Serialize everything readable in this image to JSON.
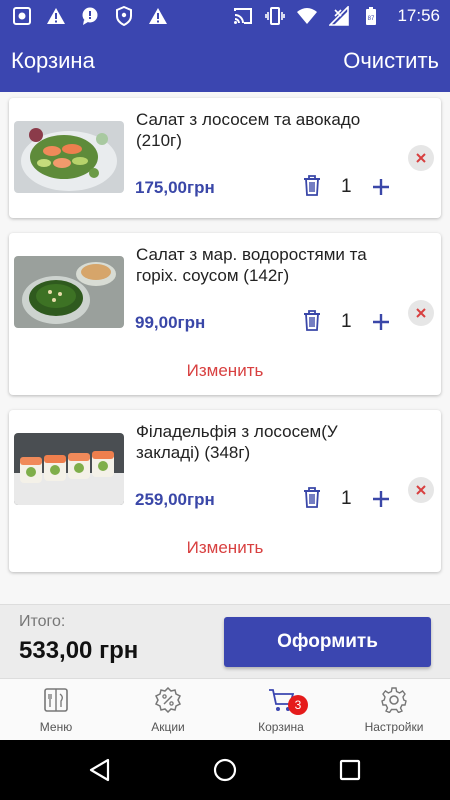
{
  "status_bar": {
    "time": "17:56",
    "left_icons": [
      "screenshot-icon",
      "warning-icon",
      "chat-alert-icon",
      "shield-icon",
      "warning-icon"
    ],
    "right_icons": [
      "cast-icon",
      "vibrate-icon",
      "wifi-icon",
      "signal-icon",
      "battery-icon"
    ],
    "battery_level": "87"
  },
  "app_bar": {
    "title": "Корзина",
    "clear_label": "Очистить"
  },
  "cart": {
    "items": [
      {
        "name": "Салат з лососем та авокадо (210г)",
        "price": "175,00грн",
        "quantity": "1",
        "change_label": ""
      },
      {
        "name": "Салат з мар. водоростями та горіх. соусом (142г)",
        "price": "99,00грн",
        "quantity": "1",
        "change_label": "Изменить"
      },
      {
        "name": "Філадельфія з лососем(У закладі) (348г)",
        "price": "259,00грн",
        "quantity": "1",
        "change_label": "Изменить"
      }
    ]
  },
  "footer": {
    "total_label": "Итого:",
    "total_value": "533,00 грн",
    "checkout_label": "Оформить"
  },
  "bottom_nav": {
    "items": [
      {
        "label": "Меню",
        "icon": "menu-book-icon"
      },
      {
        "label": "Акции",
        "icon": "discount-icon"
      },
      {
        "label": "Корзина",
        "icon": "cart-icon",
        "badge": "3",
        "active": true
      },
      {
        "label": "Настройки",
        "icon": "gear-icon"
      }
    ]
  },
  "colors": {
    "primary": "#3b46b0",
    "price": "#3a47a8",
    "change_link": "#d84040",
    "badge": "#e51b1b"
  }
}
